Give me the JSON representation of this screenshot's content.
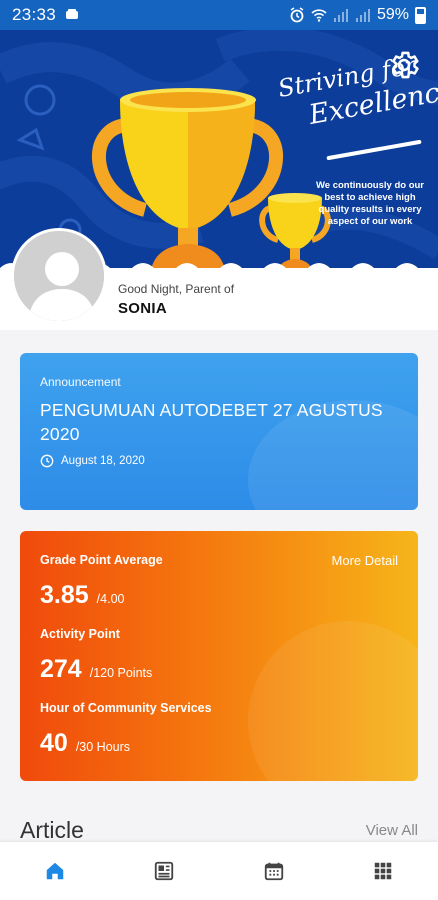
{
  "status_bar": {
    "time": "23:33",
    "battery": "59%",
    "icons": [
      "notification-icon",
      "alarm-icon",
      "wifi-icon",
      "signal-icon",
      "signal-icon",
      "battery-icon"
    ]
  },
  "hero": {
    "title_line1": "Striving for",
    "title_line2": "Excellence",
    "subtitle": "We continuously do our best to achieve high quality results in every aspect of our work",
    "settings_icon": "gear-icon"
  },
  "profile": {
    "greeting": "Good Night, Parent of",
    "child_name": "SONIA"
  },
  "announcement": {
    "label": "Announcement",
    "title": "PENGUMUAN AUTODEBET 27 AGUSTUS 2020",
    "date": "August 18, 2020"
  },
  "grades": {
    "gpa_label": "Grade Point Average",
    "gpa_value": "3.85",
    "gpa_max": "/4.00",
    "more_detail": "More Detail",
    "activity_label": "Activity Point",
    "activity_value": "274",
    "activity_max": "/120 Points",
    "community_label": "Hour of Community Services",
    "community_value": "40",
    "community_max": "/30 Hours"
  },
  "article": {
    "title": "Article",
    "view_all": "View All"
  },
  "bottom_nav": {
    "items": [
      "home-icon",
      "news-icon",
      "calendar-icon",
      "apps-grid-icon"
    ],
    "active_color": "#1e88e5",
    "inactive_color": "#444444"
  },
  "colors": {
    "status_bar": "#1565c0",
    "announcement": "#3a9bec",
    "grade_gradient_start": "#f04a0c",
    "grade_gradient_end": "#f6b51a"
  }
}
